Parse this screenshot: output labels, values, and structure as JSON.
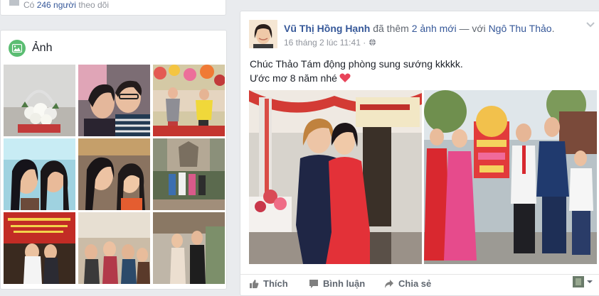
{
  "followers": {
    "prefix": "Có",
    "count": "246 người",
    "suffix": "theo dõi"
  },
  "photos": {
    "title": "Ảnh",
    "tiles": [
      {
        "name": "photo-flowers"
      },
      {
        "name": "photo-couple-selfie"
      },
      {
        "name": "photo-flower-garden"
      },
      {
        "name": "photo-two-girls-selfie"
      },
      {
        "name": "photo-girls-closeup"
      },
      {
        "name": "photo-statue-group"
      },
      {
        "name": "photo-graduation-banner"
      },
      {
        "name": "photo-dinner-group"
      },
      {
        "name": "photo-friends-posing"
      }
    ]
  },
  "post": {
    "author": "Vũ Thị Hồng Hạnh",
    "action": "đã thêm",
    "photo_count_link": "2 ảnh mới",
    "with_sep": "— với",
    "tagged": "Ngô Thu Thảo",
    "period": ".",
    "time": "16 tháng 2 lúc 11:41 ·",
    "text_line1": "Chúc Thảo Tám động phòng sung sướng kkkkk.",
    "text_line2": "Ước mơ 8 năm nhé",
    "actions": {
      "like": "Thích",
      "comment": "Bình luận",
      "share": "Chia sẻ"
    }
  }
}
